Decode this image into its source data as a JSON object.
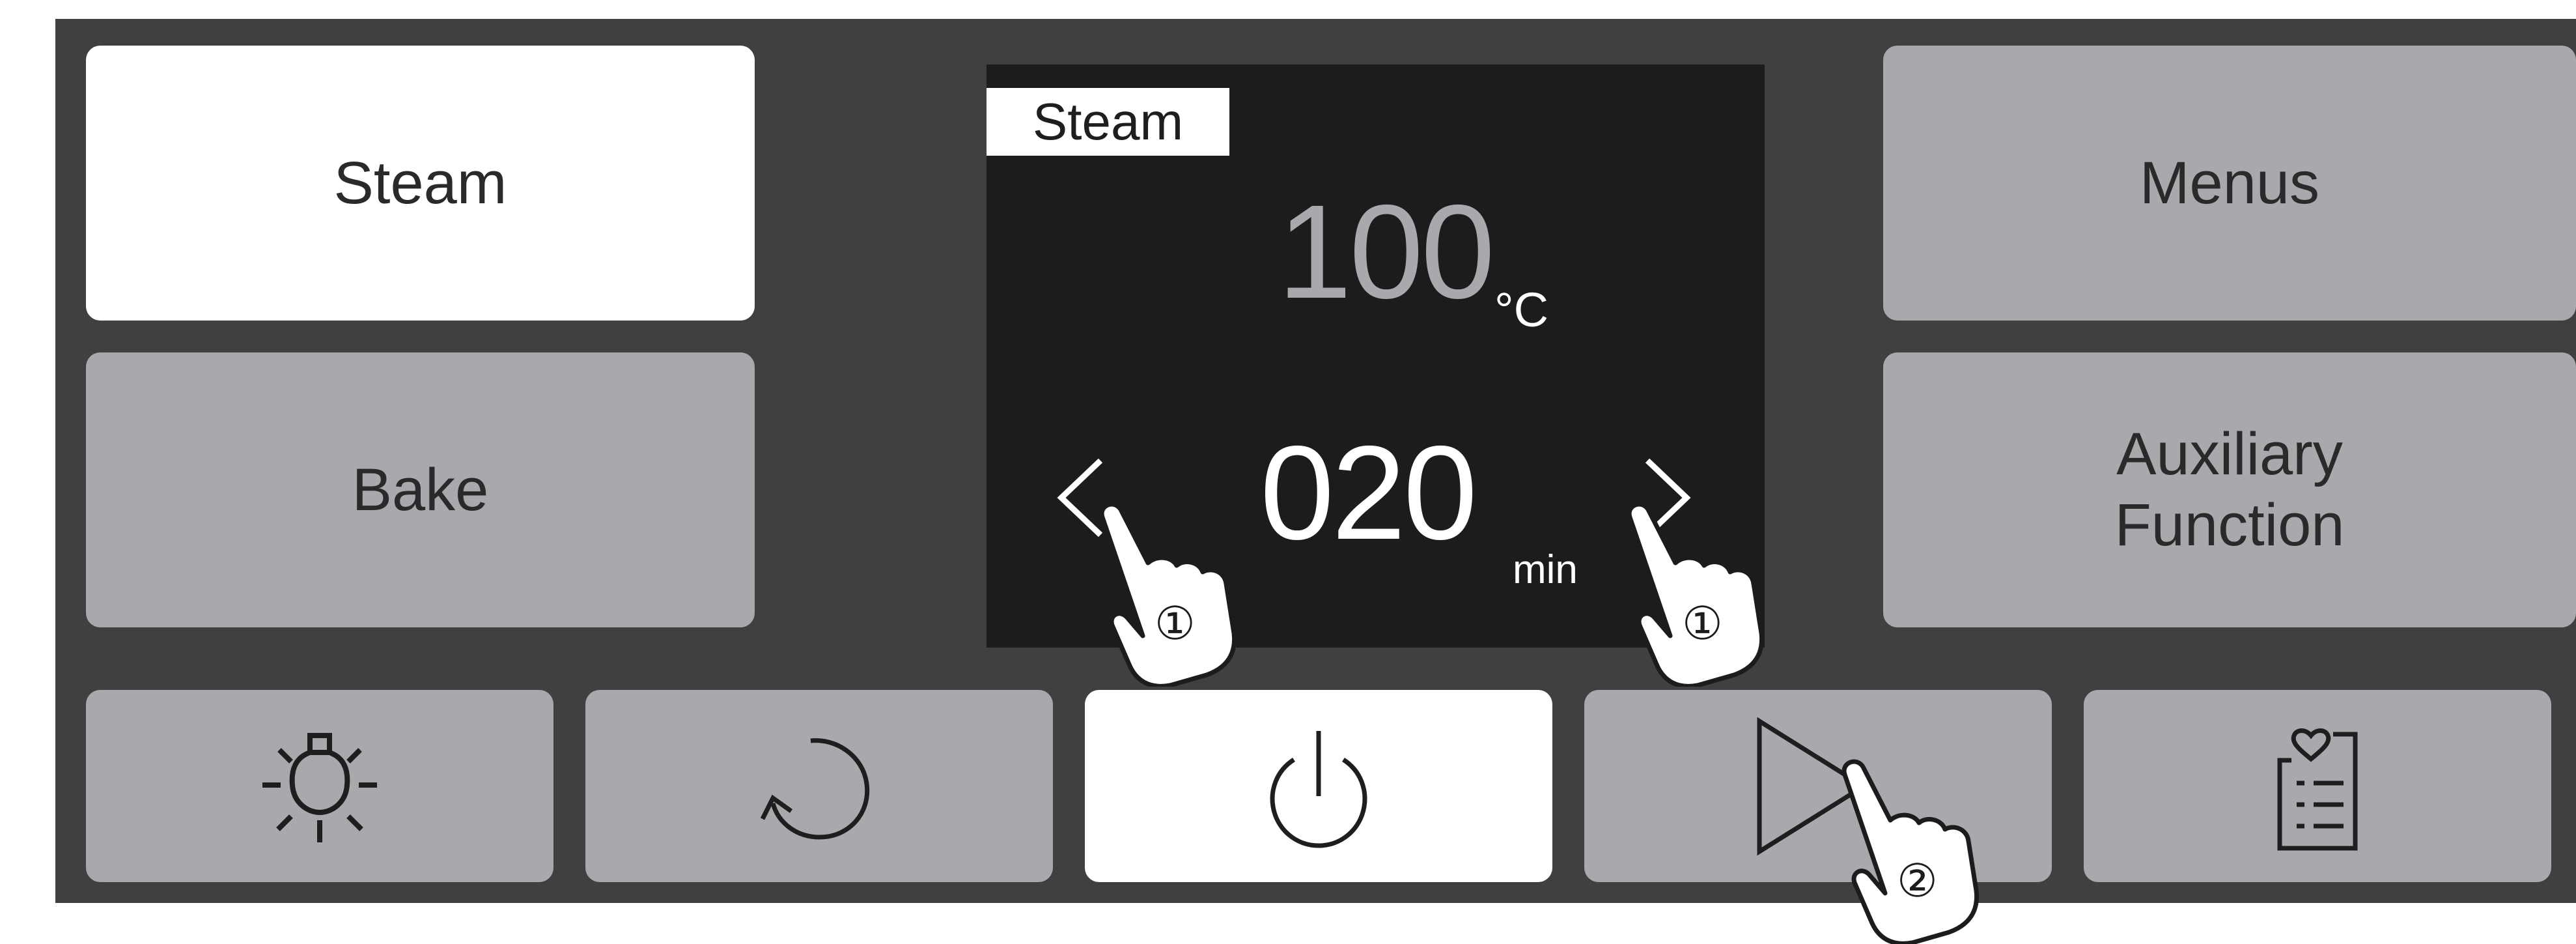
{
  "modes": {
    "steam_label": "Steam",
    "bake_label": "Bake",
    "menus_label": "Menus",
    "auxiliary_label": "Auxiliary\nFunction"
  },
  "display": {
    "mode_tag": "Steam",
    "temperature": "100",
    "temperature_unit": "°C",
    "time": "020",
    "time_unit": "min",
    "step_left": "①",
    "step_right": "①"
  },
  "bottom_bar": {
    "items": [
      {
        "icon": "oven-light-icon"
      },
      {
        "icon": "rotate-icon"
      },
      {
        "icon": "power-icon"
      },
      {
        "icon": "play-icon",
        "step": "②"
      },
      {
        "icon": "favorites-list-icon"
      }
    ]
  },
  "colors": {
    "panel_bg": "#404040",
    "button_gray": "#a7a9ac",
    "button_selected": "#ffffff",
    "display_bg": "#1c1c1c"
  }
}
